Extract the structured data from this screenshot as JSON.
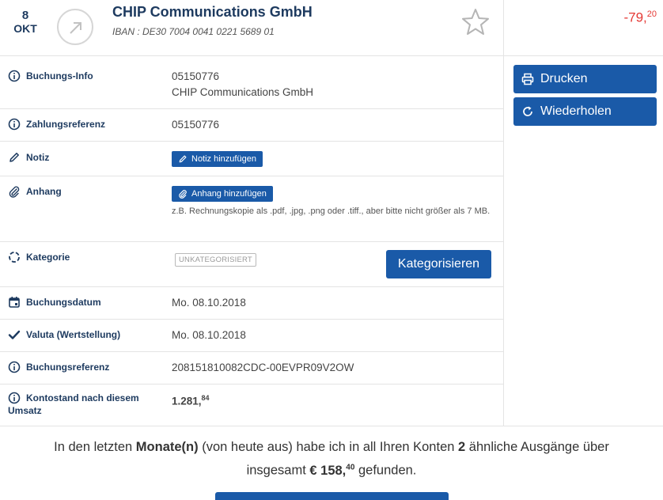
{
  "header": {
    "date_day": "8",
    "date_month": "OKT",
    "direction_icon": "arrow-up-right-icon",
    "payee": "CHIP Communications GmbH",
    "iban": "IBAN : DE30 7004 0041 0221 5689 01",
    "favorite_icon": "star-outline-icon",
    "amount_main": "-79,",
    "amount_cents": "20",
    "amount_color": "#e53935"
  },
  "details": {
    "booking_info": {
      "label": "Buchungs-Info",
      "line1": "05150776",
      "line2": "CHIP Communications GmbH"
    },
    "payment_ref": {
      "label": "Zahlungsreferenz",
      "value": "05150776"
    },
    "note": {
      "label": "Notiz",
      "button": "Notiz hinzufügen"
    },
    "attachment": {
      "label": "Anhang",
      "button": "Anhang hinzufügen",
      "hint": "z.B. Rechnungskopie als .pdf, .jpg, .png oder .tiff., aber bitte nicht größer als 7 MB."
    },
    "category": {
      "label": "Kategorie",
      "tag": "UNKATEGORISIERT",
      "button": "Kategorisieren"
    },
    "booking_date": {
      "label": "Buchungsdatum",
      "value": "Mo. 08.10.2018"
    },
    "value_date": {
      "label": "Valuta (Wertstellung)",
      "value": "Mo. 08.10.2018"
    },
    "booking_ref": {
      "label": "Buchungsreferenz",
      "value": "208151810082CDC-00EVPR09V2OW"
    },
    "balance": {
      "label": "Kontostand nach diesem Umsatz",
      "value_main": "1.281,",
      "value_cents": "84",
      "color": "#2e9e3e"
    }
  },
  "actions": {
    "print": "Drucken",
    "repeat": "Wiederholen"
  },
  "footer": {
    "t1": "In den letzten ",
    "t2": "Monate(n)",
    "t3": " (von heute aus) habe ich in all Ihren Konten ",
    "t4": "2",
    "t5": " ähnliche Ausgänge über",
    "t6": "insgesamt ",
    "t7": "€ 158,",
    "t8": "40",
    "t9": " gefunden."
  },
  "colors": {
    "primary": "#1a5aa8",
    "heading": "#1d3a5f",
    "negative": "#e53935",
    "positive": "#2e9e3e"
  }
}
